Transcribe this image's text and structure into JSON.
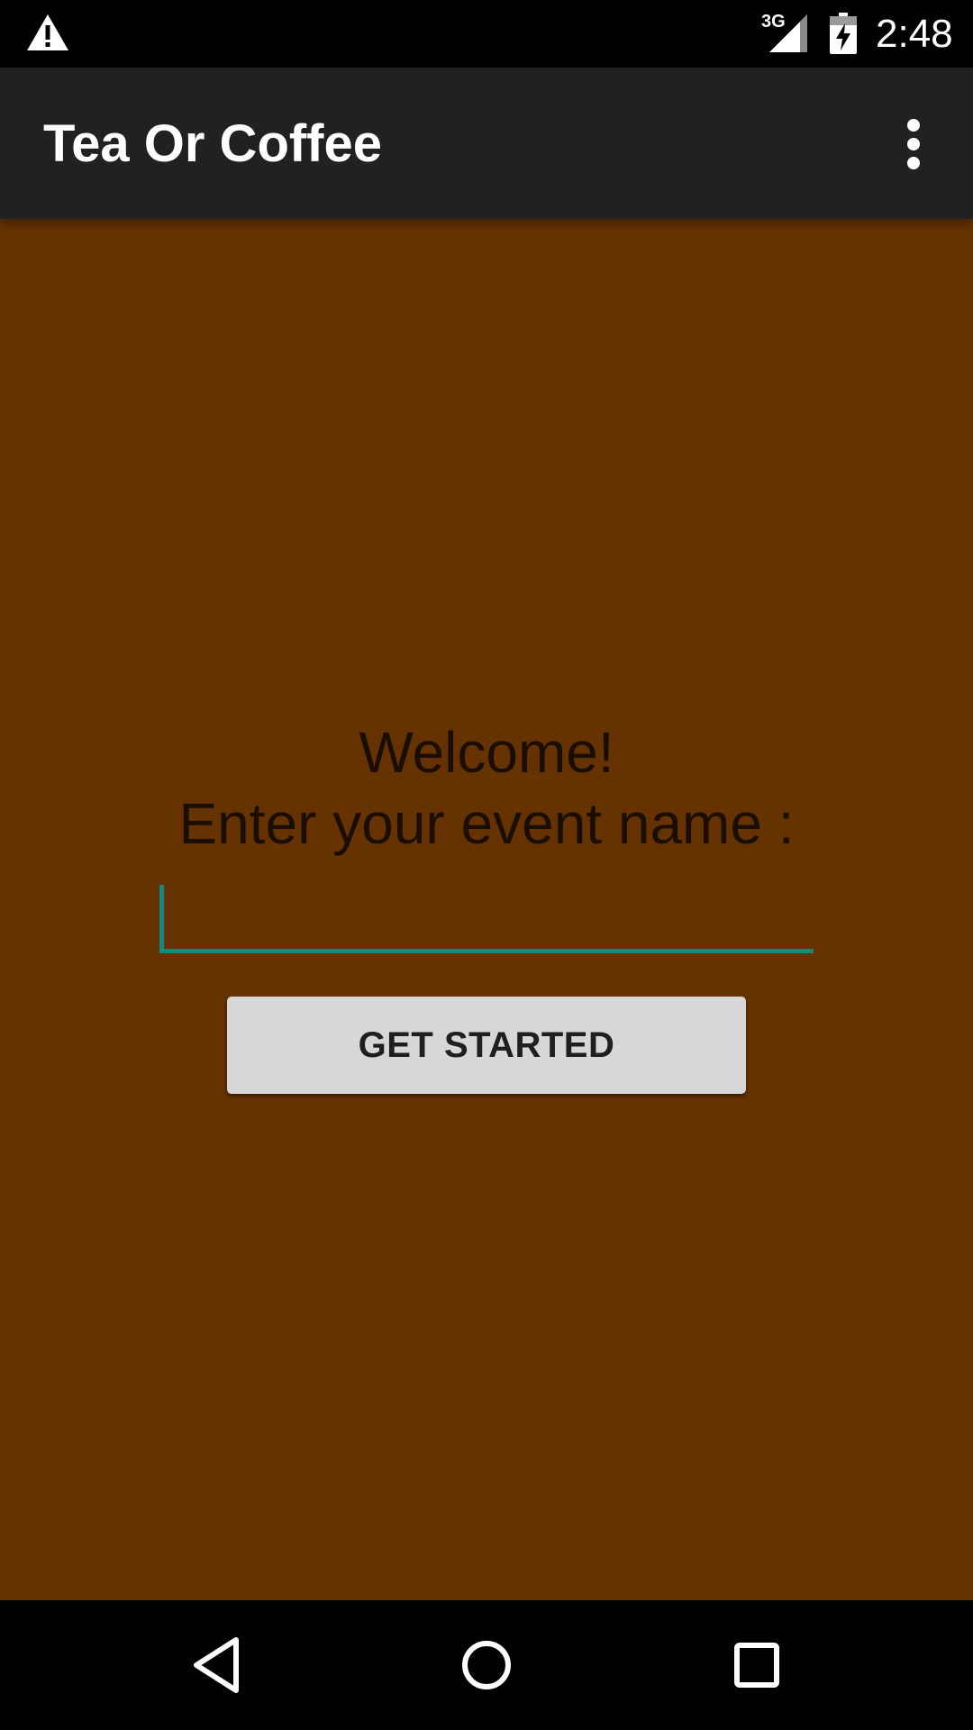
{
  "status_bar": {
    "alert_icon": "warning-icon",
    "network_type": "3G",
    "signal_icon": "cell-signal-icon",
    "battery_icon": "battery-charging-icon",
    "time": "2:48"
  },
  "app_bar": {
    "title": "Tea Or Coffee",
    "menu_icon": "more-vert-icon"
  },
  "main": {
    "welcome_text": "Welcome!",
    "prompt_text": "Enter your event name :",
    "event_input": {
      "value": "",
      "placeholder": ""
    },
    "get_started_label": "GET STARTED"
  },
  "nav_bar": {
    "back_icon": "back-triangle-icon",
    "home_icon": "home-circle-icon",
    "recents_icon": "recents-square-icon"
  },
  "colors": {
    "background": "#663300",
    "app_bar": "#212121",
    "accent": "#128a7f",
    "button": "#d6d7d7",
    "text_dark": "#1a0e02"
  }
}
